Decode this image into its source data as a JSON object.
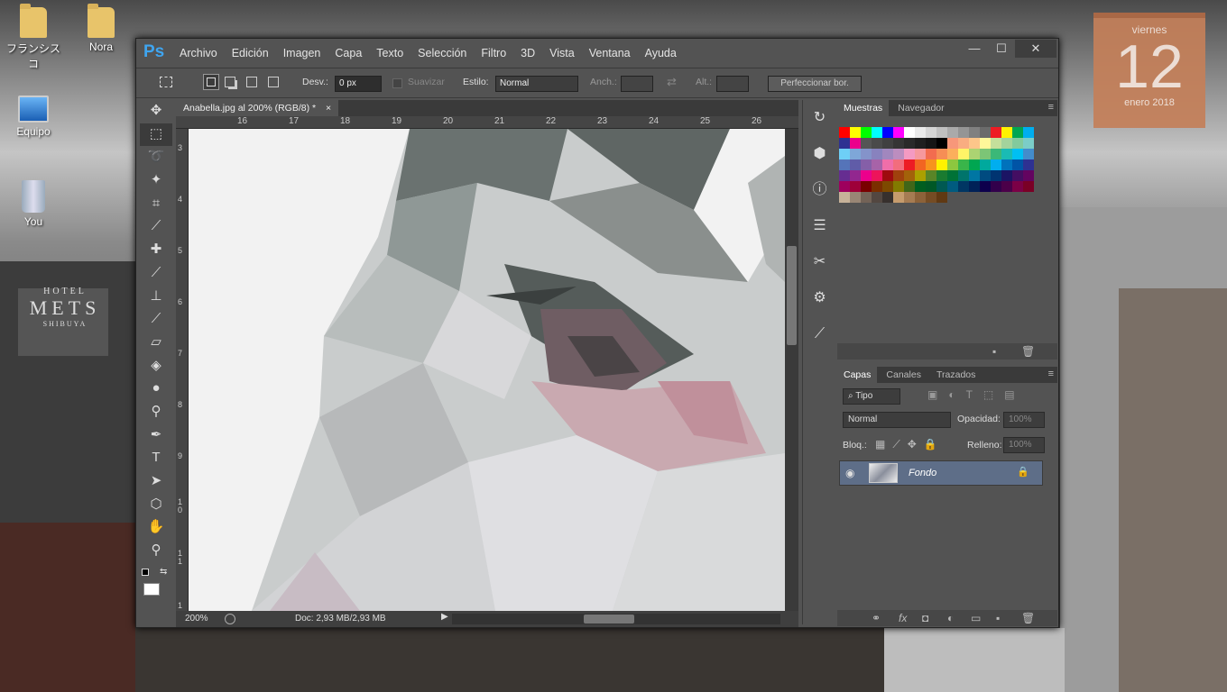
{
  "desktop": {
    "icons": [
      {
        "label": "フランシスコ",
        "icon": "user-folder-icon"
      },
      {
        "label": "Nora",
        "icon": "folder-icon"
      },
      {
        "label": "Equipo",
        "icon": "computer-icon"
      },
      {
        "label": "You",
        "icon": "recycle-bin-icon"
      }
    ],
    "calendar": {
      "weekday": "viernes",
      "day": "12",
      "month_year": "enero 2018"
    },
    "sign": {
      "line1": "HOTEL",
      "line2": "METS",
      "line3": "SHIBUYA"
    }
  },
  "app": {
    "logo": "Ps",
    "menu": [
      "Archivo",
      "Edición",
      "Imagen",
      "Capa",
      "Texto",
      "Selección",
      "Filtro",
      "3D",
      "Vista",
      "Ventana",
      "Ayuda"
    ],
    "window_buttons": {
      "minimize": "—",
      "maximize": "☐",
      "close": "✕"
    }
  },
  "options_bar": {
    "feather_label": "Desv.:",
    "feather_value": "0 px",
    "antialias_label": "Suavizar",
    "style_label": "Estilo:",
    "style_value": "Normal",
    "width_label": "Anch.:",
    "height_label": "Alt.:",
    "refine_button": "Perfeccionar bor."
  },
  "document": {
    "tab_title": "Anabella.jpg al 200% (RGB/8) *",
    "tab_close": "×",
    "ruler_h": [
      "16",
      "17",
      "18",
      "19",
      "20",
      "21",
      "22",
      "23",
      "24",
      "25",
      "26"
    ],
    "ruler_v": [
      "3",
      "4",
      "5",
      "6",
      "7",
      "8",
      "9",
      "1 0",
      "1 1",
      "1"
    ],
    "zoom": "200%",
    "doc_info": "Doc: 2,93 MB/2,93 MB"
  },
  "swatches_panel": {
    "tabs": [
      "Muestras",
      "Navegador"
    ],
    "colors": [
      "#ff0000",
      "#ffff00",
      "#00ff00",
      "#00ffff",
      "#0000ff",
      "#ff00ff",
      "#ffffff",
      "#eaeaea",
      "#d5d5d5",
      "#c0c0c0",
      "#aaaaaa",
      "#959595",
      "#808080",
      "#6b6b6b",
      "#ed1c24",
      "#fff200",
      "#00a651",
      "#00aeef",
      "#2e3192",
      "#ec008c",
      "#555555",
      "#4a4a4a",
      "#404040",
      "#353535",
      "#2a2a2a",
      "#1f1f1f",
      "#151515",
      "#000000",
      "#f7977a",
      "#f9ad81",
      "#fdc68a",
      "#fff79a",
      "#c4df9b",
      "#a3d39c",
      "#82ca9d",
      "#7bcdc8",
      "#6ecff6",
      "#7ea7d8",
      "#8493ca",
      "#8882be",
      "#a187be",
      "#bc8dbf",
      "#f49ac2",
      "#f6989d",
      "#f26c4f",
      "#f68e55",
      "#fbaf5c",
      "#fff467",
      "#acd372",
      "#7cc576",
      "#3bb878",
      "#1abbb4",
      "#00bff3",
      "#438ccb",
      "#5574b9",
      "#605ca8",
      "#855fa8",
      "#a763a8",
      "#f06ea9",
      "#f26d7d",
      "#ed1c24",
      "#f26522",
      "#f7941d",
      "#fff200",
      "#8dc73f",
      "#39b54a",
      "#00a651",
      "#00a99d",
      "#00aeef",
      "#0072bc",
      "#0054a6",
      "#2e3192",
      "#662d91",
      "#92278f",
      "#ec008c",
      "#ed145b",
      "#9e0b0f",
      "#a0410d",
      "#a3620a",
      "#aba000",
      "#598527",
      "#1a7b30",
      "#007236",
      "#00746b",
      "#0076a3",
      "#004b80",
      "#003471",
      "#1b1464",
      "#440e62",
      "#630460",
      "#9e005d",
      "#9e0039",
      "#790000",
      "#7b2e00",
      "#7d4900",
      "#827b00",
      "#406618",
      "#005e20",
      "#005826",
      "#005952",
      "#005b7f",
      "#003663",
      "#002157",
      "#0d004c",
      "#32004b",
      "#4b0049",
      "#7b0046",
      "#7a0026",
      "#c7b299",
      "#998675",
      "#736357",
      "#534741",
      "#37302d",
      "#c69c6d",
      "#a67c52",
      "#8c6239",
      "#754c24",
      "#603913"
    ],
    "footer_icons": [
      "new-swatch-icon",
      "trash-icon"
    ]
  },
  "layers_panel": {
    "tabs": [
      "Capas",
      "Canales",
      "Trazados"
    ],
    "filter_label": "Tipo",
    "blend_mode": "Normal",
    "opacity_label": "Opacidad:",
    "opacity_value": "100%",
    "lock_label": "Bloq.:",
    "fill_label": "Relleno:",
    "fill_value": "100%",
    "layers": [
      {
        "name": "Fondo",
        "visible": true,
        "locked": true
      }
    ],
    "footer_icons": [
      "link-icon",
      "fx-icon",
      "mask-icon",
      "adjustment-icon",
      "group-folder-icon",
      "new-layer-icon",
      "trash-icon"
    ]
  },
  "colors": {
    "app_bg": "#535353",
    "panel_dark": "#3a3a3a",
    "ps_blue": "#3fa5f0",
    "layer_selected": "#5e6e88",
    "calendar": "#c4805a"
  }
}
